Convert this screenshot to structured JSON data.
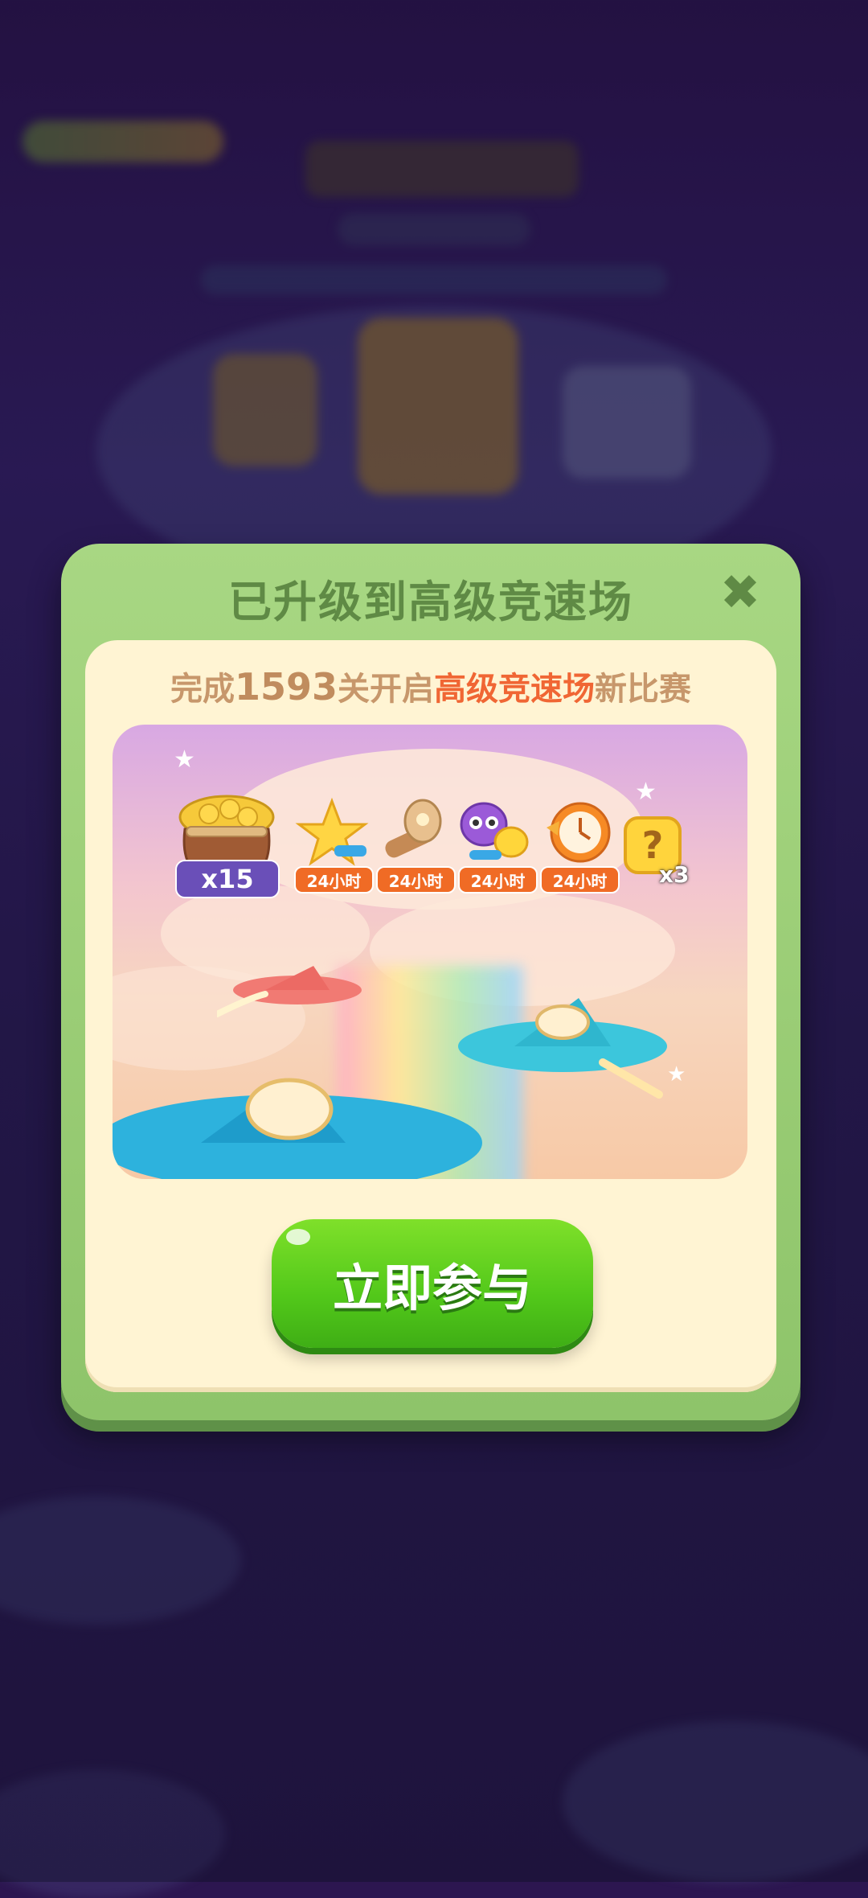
{
  "dialog": {
    "title": "已升级到高级竞速场",
    "close_label": "✖",
    "subtitle": {
      "prefix": "完成",
      "level": "1593",
      "middle": "关开启",
      "highlight": "高级竞速场",
      "suffix": "新比赛"
    },
    "rewards": [
      {
        "name": "coin-bag",
        "label": "x15"
      },
      {
        "name": "star-booster",
        "label": "24小时"
      },
      {
        "name": "hammer-booster",
        "label": "24小时"
      },
      {
        "name": "owl-chick-booster",
        "label": "24小时"
      },
      {
        "name": "clock-booster",
        "label": "24小时"
      },
      {
        "name": "mystery-box",
        "label": "x3"
      }
    ],
    "join_button": "立即参与"
  },
  "colors": {
    "dialog_green": "#8ec46a",
    "title_green": "#5f8a45",
    "panel_cream": "#fff4d3",
    "highlight_orange": "#f06634",
    "button_green": "#52c81a",
    "tag_orange": "#f06b25"
  }
}
